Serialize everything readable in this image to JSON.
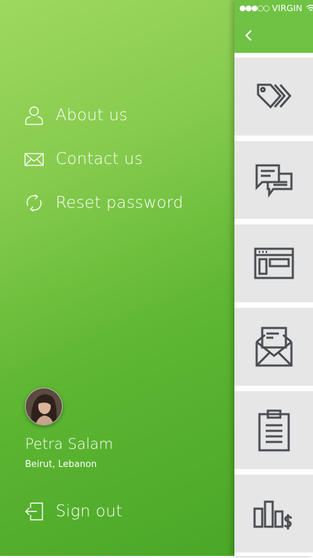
{
  "menu": [
    {
      "label": "About us",
      "icon": "user-icon"
    },
    {
      "label": "Contact us",
      "icon": "envelope-icon"
    },
    {
      "label": "Reset password",
      "icon": "refresh-icon"
    }
  ],
  "profile": {
    "name": "Petra Salam",
    "location": "Beirut, Lebanon"
  },
  "signout": {
    "label": "Sign out"
  },
  "status_bar": {
    "signal": "●●●○○",
    "carrier": "VIRGIN"
  },
  "colors": {
    "drawer_light": "#9ed85f",
    "drawer_dark": "#4aa727",
    "header": "#6fc243",
    "tile": "#e5e6e5",
    "icon": "#4a4d52"
  },
  "tiles": [
    {
      "icon": "tags-icon"
    },
    {
      "icon": "chat-icon"
    },
    {
      "icon": "layout-icon"
    },
    {
      "icon": "open-envelope-icon"
    },
    {
      "icon": "clipboard-icon"
    },
    {
      "icon": "chart-dollar-icon"
    }
  ]
}
